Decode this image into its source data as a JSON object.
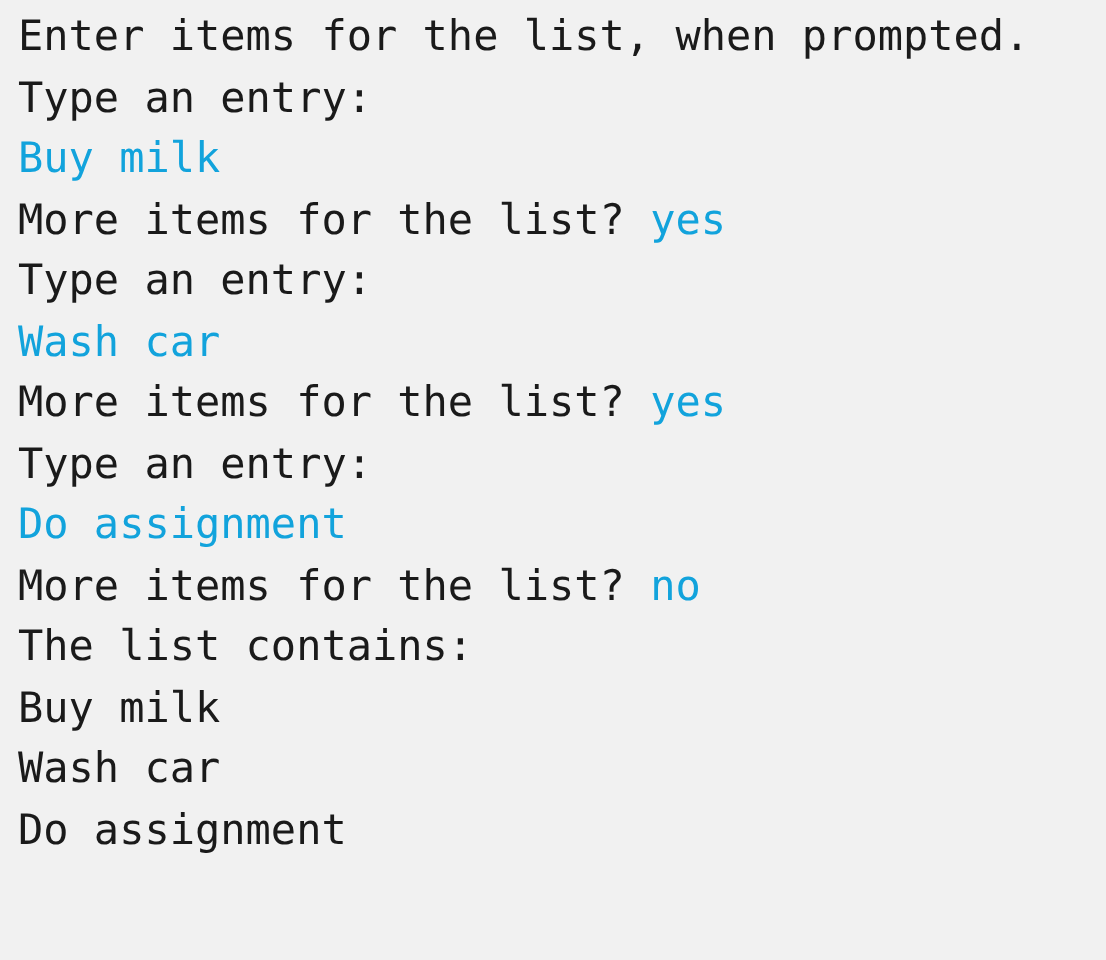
{
  "console": {
    "lines": [
      {
        "segments": [
          {
            "kind": "output",
            "text": "Enter items for the list, when prompted."
          }
        ]
      },
      {
        "segments": [
          {
            "kind": "output",
            "text": "Type an entry:"
          }
        ]
      },
      {
        "segments": [
          {
            "kind": "input",
            "text": "Buy milk"
          }
        ]
      },
      {
        "segments": [
          {
            "kind": "output",
            "text": "More items for the list?"
          },
          {
            "kind": "input",
            "text": "yes"
          }
        ]
      },
      {
        "segments": [
          {
            "kind": "output",
            "text": "Type an entry:"
          }
        ]
      },
      {
        "segments": [
          {
            "kind": "input",
            "text": "Wash car"
          }
        ]
      },
      {
        "segments": [
          {
            "kind": "output",
            "text": "More items for the list?"
          },
          {
            "kind": "input",
            "text": "yes"
          }
        ]
      },
      {
        "segments": [
          {
            "kind": "output",
            "text": "Type an entry:"
          }
        ]
      },
      {
        "segments": [
          {
            "kind": "input",
            "text": "Do assignment"
          }
        ]
      },
      {
        "segments": [
          {
            "kind": "output",
            "text": "More items for the list?"
          },
          {
            "kind": "input",
            "text": "no"
          }
        ]
      },
      {
        "segments": [
          {
            "kind": "output",
            "text": "The list contains:"
          }
        ]
      },
      {
        "segments": [
          {
            "kind": "output",
            "text": "Buy milk"
          }
        ]
      },
      {
        "segments": [
          {
            "kind": "output",
            "text": "Wash car"
          }
        ]
      },
      {
        "segments": [
          {
            "kind": "output",
            "text": "Do assignment"
          }
        ]
      }
    ]
  }
}
